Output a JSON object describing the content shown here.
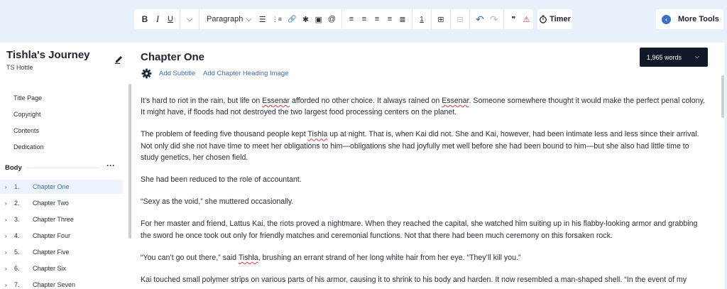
{
  "toolbar": {
    "bold": "B",
    "italic": "I",
    "underline": "U",
    "more_format": "⌵",
    "paragraph_label": "Paragraph",
    "paragraph_chevron": "⌵",
    "bullet_list": "☰",
    "numbered_list": "⋮≡",
    "link": "🔗",
    "asterisk": "✱",
    "image": "▣",
    "mention": "@",
    "align_left": "≡",
    "align_center": "≡",
    "align_right": "≡",
    "align_justify": "≡",
    "align_full": "≣",
    "footnote": "1",
    "break": "⊞",
    "divider": "⊟",
    "undo": "↶",
    "redo": "↷",
    "quote": "❞",
    "warning": "⚠",
    "timer_label": "Timer",
    "more_tools_label": "More Tools",
    "more_tools_icon": "‹"
  },
  "sidebar": {
    "book_title": "Tishla's Journey",
    "author": "TS Hottle",
    "front_matter": [
      "Title Page",
      "Copyright",
      "Contents",
      "Dedication"
    ],
    "body_heading": "Body",
    "body_menu": "···",
    "chapters": [
      {
        "chev": "›",
        "num": "1.",
        "title": "Chapter One",
        "active": true
      },
      {
        "chev": "›",
        "num": "2.",
        "title": "Chapter Two",
        "active": false
      },
      {
        "chev": "›",
        "num": "3.",
        "title": "Chapter Three",
        "active": false
      },
      {
        "chev": "›",
        "num": "4.",
        "title": "Chapter Four",
        "active": false
      },
      {
        "chev": "›",
        "num": "5.",
        "title": "Chapter Five",
        "active": false
      },
      {
        "chev": "›",
        "num": "6.",
        "title": "Chapter Six",
        "active": false
      },
      {
        "chev": "›",
        "num": "7.",
        "title": "Chapter Seven",
        "active": false
      }
    ]
  },
  "editor": {
    "chapter_title": "Chapter One",
    "add_subtitle": "Add Subtitle",
    "add_heading_image": "Add Chapter Heading Image",
    "word_count": "1,965 words",
    "word_count_chevron": "⌵",
    "paragraphs": [
      {
        "parts": [
          {
            "t": "It’s hard to riot in the rain, but life on "
          },
          {
            "t": "Essenar",
            "sp": true
          },
          {
            "t": " afforded no other choice. It always rained on "
          },
          {
            "t": "Essenar",
            "sp": true
          },
          {
            "t": ". Someone somewhere thought it would make the perfect penal colony. It might have, if floods had not destroyed the two largest food processing centers on the planet."
          }
        ]
      },
      {
        "parts": [
          {
            "t": "The problem of feeding five thousand people kept "
          },
          {
            "t": "Tishla",
            "sp": true
          },
          {
            "t": " up at night. That is, when Kai did not. She and Kai, however, had been intimate less and less since their arrival. Not only did she not have time to meet her obligations to him—obligations she had joyfully met well before she had been bound to him—but she also had little time to study genetics, her chosen field."
          }
        ]
      },
      {
        "parts": [
          {
            "t": "She had been reduced to the role of accountant."
          }
        ]
      },
      {
        "parts": [
          {
            "t": "“Sexy as the void,” she muttered occasionally."
          }
        ]
      },
      {
        "parts": [
          {
            "t": "For her master and friend, Lattus Kai, the riots proved a nightmare. When they reached the capital, she watched him suiting up in his flabby-looking armor and grabbing the sword he once took out only for friendly matches and ceremonial functions. Not that there had been much ceremony on this forsaken rock."
          }
        ]
      },
      {
        "parts": [
          {
            "t": "“You can’t go out there,” said "
          },
          {
            "t": "Tishla",
            "sp": true
          },
          {
            "t": ", brushing an errant strand of her long white hair from her eye. “They’ll kill you.”"
          }
        ]
      },
      {
        "parts": [
          {
            "t": "Kai touched small polymer strips on various parts of his armor, causing it to shrink to his body and harden. It now resembled a man-shaped shell. “In the event of my"
          }
        ]
      }
    ]
  },
  "colors": {
    "background": "#e8f0fb",
    "accent": "#3d6fc4",
    "active_chapter_bg": "#edf4ff",
    "word_count_bg": "#111827",
    "warning": "#d03030"
  }
}
